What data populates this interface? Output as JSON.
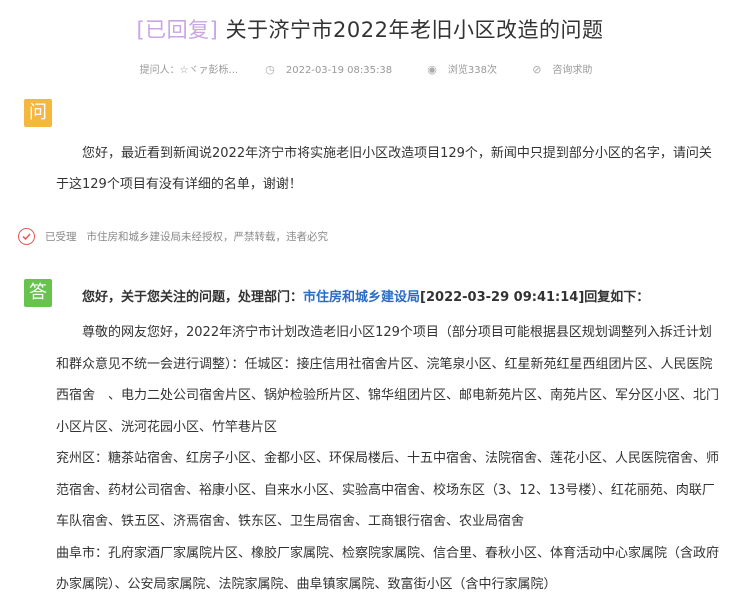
{
  "header": {
    "status": "[已回复]",
    "title": "关于济宁市2022年老旧小区改造的问题"
  },
  "meta": {
    "asker": "提问人：☆ヾァ彭栎...",
    "date": "2022-03-19 08:35:38",
    "views": "浏览338次",
    "category": "咨询求助"
  },
  "question": {
    "badge": "问",
    "text": "您好，最近看到新闻说2022年济宁市将实施老旧小区改造项目129个，新闻中只提到部分小区的名字，请问关于这129个项目有没有详细的名单，谢谢！"
  },
  "state": {
    "label": "已受理",
    "note": "市住房和城乡建设局未经授权，严禁转载，违者必究"
  },
  "answer": {
    "badge": "答",
    "prefix": "您好，关于您关注的问题，处理部门：",
    "dept": "市住房和城乡建设局",
    "suffix": "[2022-03-29 09:41:14]回复如下：",
    "p1": "尊敬的网友您好，2022年济宁市计划改造老旧小区129个项目（部分项目可能根据县区规划调整列入拆迁计划和群众意见不统一会进行调整）：任城区：接庄信用社宿舍片区、浣笔泉小区、红星新苑红星西组团片区、人民医院西宿舍　、电力二处公司宿舍片区、锅炉检验所片区、锦华组团片区、邮电新苑片区、南苑片区、军分区小区、北门小区片区、洸河花园小区、竹竿巷片区",
    "p2": "兖州区：糖茶站宿舍、红房子小区、金都小区、环保局楼后、十五中宿舍、法院宿舍、莲花小区、人民医院宿舍、师范宿舍、药材公司宿舍、裕康小区、自来水小区、实验高中宿舍、校场东区（3、12、13号楼）、红花丽苑、肉联厂车队宿舍、铁五区、济焉宿舍、铁东区、卫生局宿舍、工商银行宿舍、农业局宿舍",
    "p3": "曲阜市：孔府家酒厂家属院片区、橡胶厂家属院、检察院家属院、信合里、春秋小区、体育活动中心家属院（含政府办家属院）、公安局家属院、法院家属院、曲阜镇家属院、致富街小区（含中行家属院）"
  }
}
